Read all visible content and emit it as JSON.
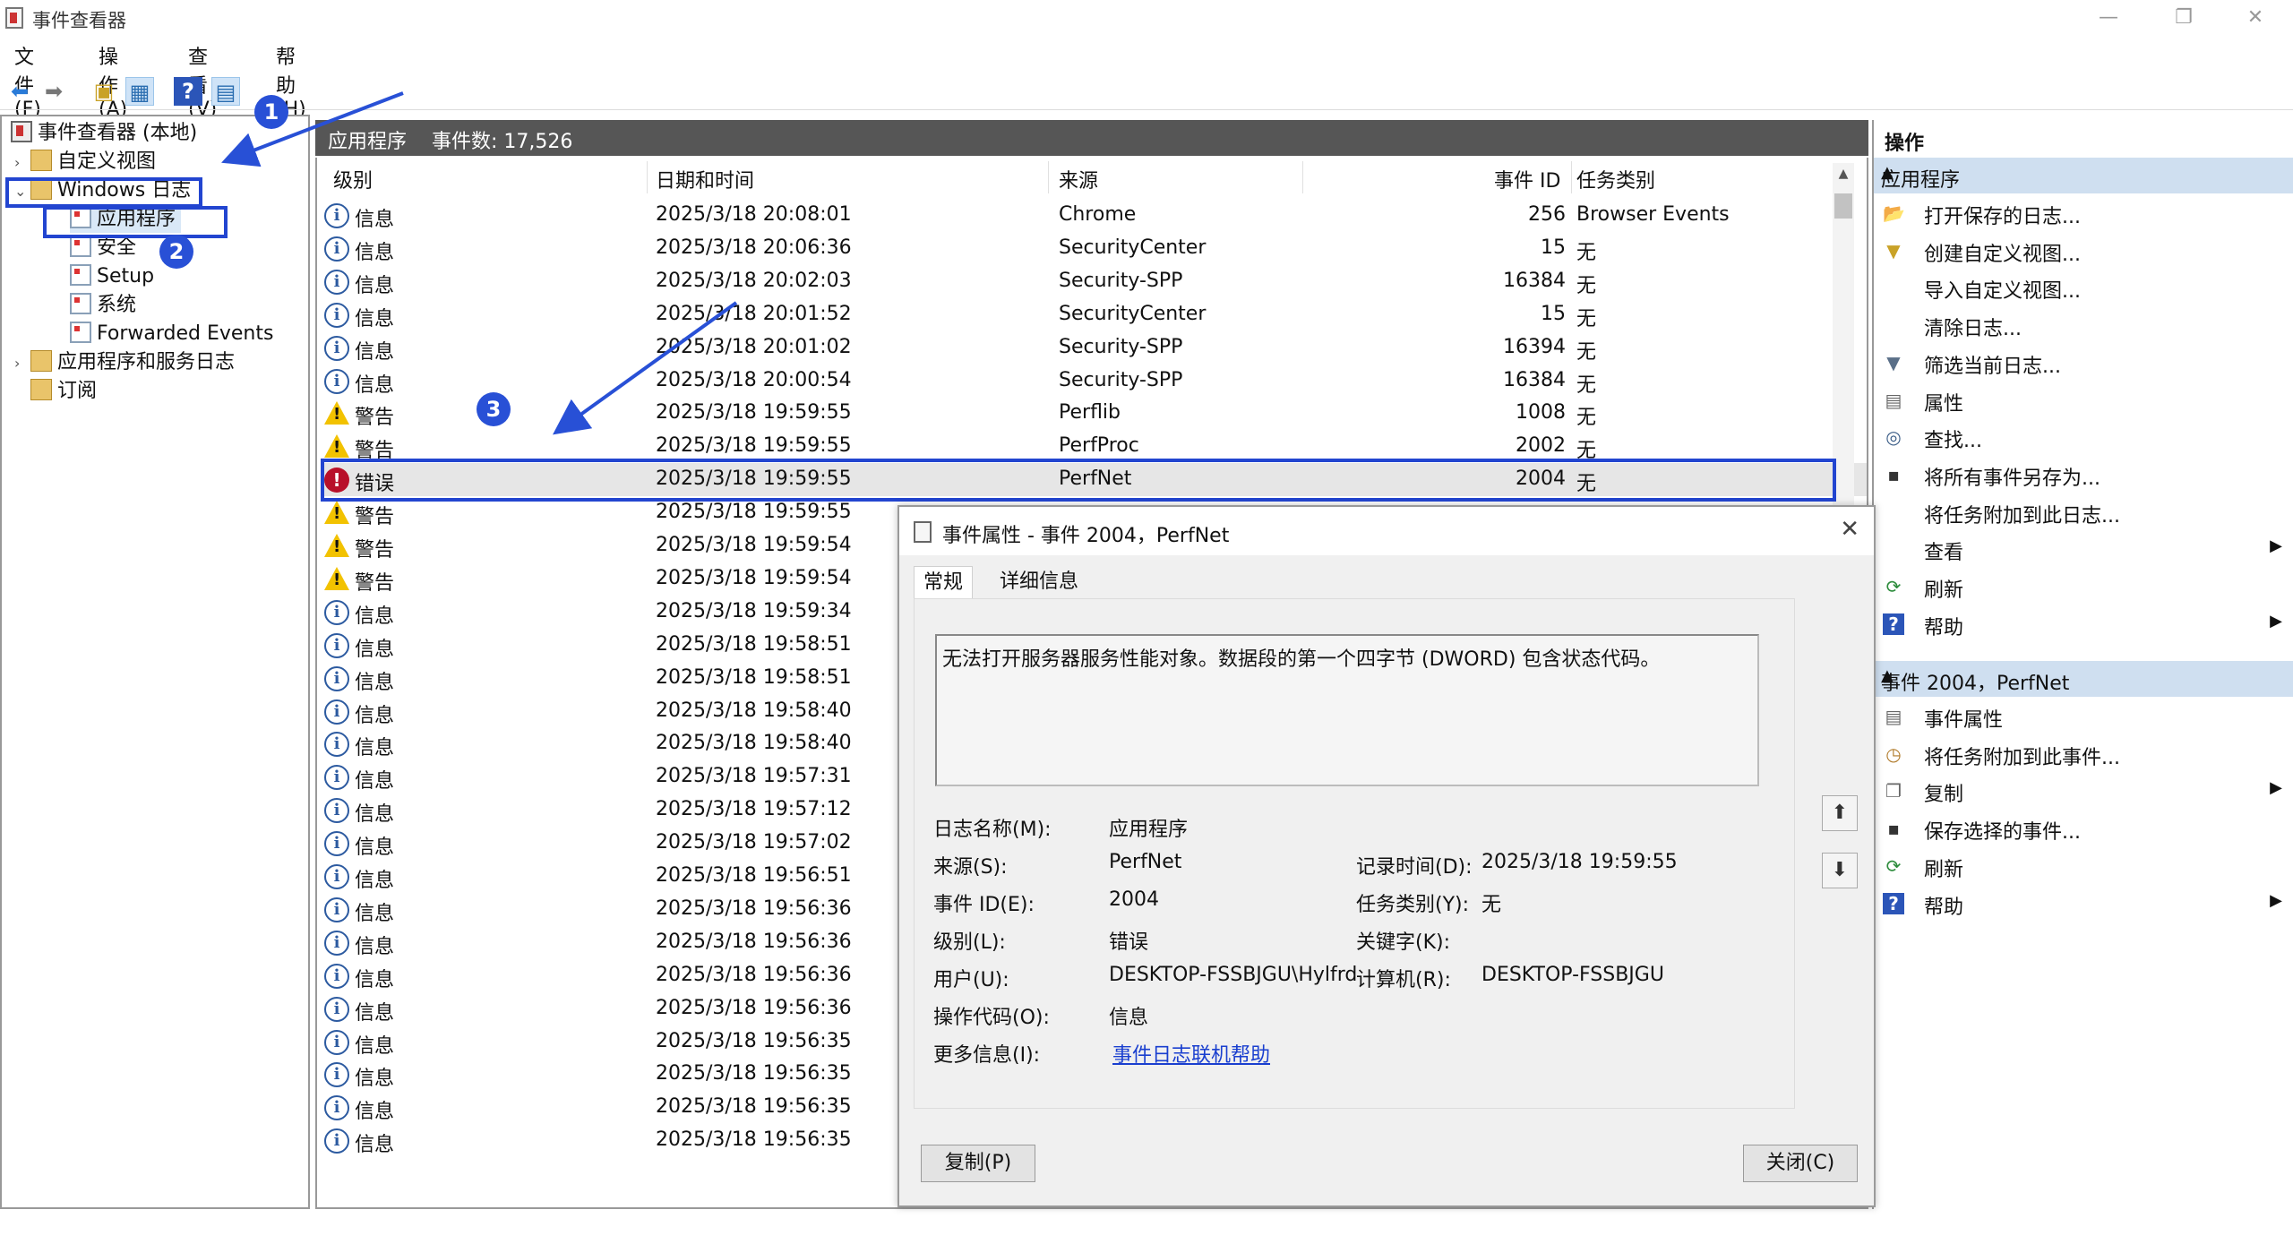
{
  "window": {
    "title": "事件查看器",
    "controls": {
      "min": "—",
      "max": "❐",
      "close": "✕"
    }
  },
  "menu": [
    "文件(F)",
    "操作(A)",
    "查看(V)",
    "帮助(H)"
  ],
  "tree": {
    "root": "事件查看器 (本地)",
    "custom_views": "自定义视图",
    "windows_logs": "Windows 日志",
    "application": "应用程序",
    "security": "安全",
    "setup": "Setup",
    "system": "系统",
    "forwarded": "Forwarded Events",
    "app_service_logs": "应用程序和服务日志",
    "subscriptions": "订阅"
  },
  "list": {
    "header_title": "应用程序",
    "event_count": "事件数: 17,526",
    "columns": {
      "level": "级别",
      "datetime": "日期和时间",
      "source": "来源",
      "event_id": "事件 ID",
      "task": "任务类别"
    },
    "rows": [
      {
        "icon": "info",
        "level": "信息",
        "datetime": "2025/3/18 20:08:01",
        "source": "Chrome",
        "event_id": "256",
        "task": "Browser Events"
      },
      {
        "icon": "info",
        "level": "信息",
        "datetime": "2025/3/18 20:06:36",
        "source": "SecurityCenter",
        "event_id": "15",
        "task": "无"
      },
      {
        "icon": "info",
        "level": "信息",
        "datetime": "2025/3/18 20:02:03",
        "source": "Security-SPP",
        "event_id": "16384",
        "task": "无"
      },
      {
        "icon": "info",
        "level": "信息",
        "datetime": "2025/3/18 20:01:52",
        "source": "SecurityCenter",
        "event_id": "15",
        "task": "无"
      },
      {
        "icon": "info",
        "level": "信息",
        "datetime": "2025/3/18 20:01:02",
        "source": "Security-SPP",
        "event_id": "16394",
        "task": "无"
      },
      {
        "icon": "info",
        "level": "信息",
        "datetime": "2025/3/18 20:00:54",
        "source": "Security-SPP",
        "event_id": "16384",
        "task": "无"
      },
      {
        "icon": "warn",
        "level": "警告",
        "datetime": "2025/3/18 19:59:55",
        "source": "Perflib",
        "event_id": "1008",
        "task": "无"
      },
      {
        "icon": "warn",
        "level": "警告",
        "datetime": "2025/3/18 19:59:55",
        "source": "PerfProc",
        "event_id": "2002",
        "task": "无"
      },
      {
        "icon": "err",
        "level": "错误",
        "datetime": "2025/3/18 19:59:55",
        "source": "PerfNet",
        "event_id": "2004",
        "task": "无"
      },
      {
        "icon": "warn",
        "level": "警告",
        "datetime": "2025/3/18 19:59:55",
        "source": "",
        "event_id": "",
        "task": ""
      },
      {
        "icon": "warn",
        "level": "警告",
        "datetime": "2025/3/18 19:59:54",
        "source": "",
        "event_id": "",
        "task": ""
      },
      {
        "icon": "warn",
        "level": "警告",
        "datetime": "2025/3/18 19:59:54",
        "source": "",
        "event_id": "",
        "task": ""
      },
      {
        "icon": "info",
        "level": "信息",
        "datetime": "2025/3/18 19:59:34",
        "source": "",
        "event_id": "",
        "task": ""
      },
      {
        "icon": "info",
        "level": "信息",
        "datetime": "2025/3/18 19:58:51",
        "source": "",
        "event_id": "",
        "task": ""
      },
      {
        "icon": "info",
        "level": "信息",
        "datetime": "2025/3/18 19:58:51",
        "source": "",
        "event_id": "",
        "task": ""
      },
      {
        "icon": "info",
        "level": "信息",
        "datetime": "2025/3/18 19:58:40",
        "source": "",
        "event_id": "",
        "task": ""
      },
      {
        "icon": "info",
        "level": "信息",
        "datetime": "2025/3/18 19:58:40",
        "source": "",
        "event_id": "",
        "task": ""
      },
      {
        "icon": "info",
        "level": "信息",
        "datetime": "2025/3/18 19:57:31",
        "source": "",
        "event_id": "",
        "task": ""
      },
      {
        "icon": "info",
        "level": "信息",
        "datetime": "2025/3/18 19:57:12",
        "source": "",
        "event_id": "",
        "task": ""
      },
      {
        "icon": "info",
        "level": "信息",
        "datetime": "2025/3/18 19:57:02",
        "source": "",
        "event_id": "",
        "task": ""
      },
      {
        "icon": "info",
        "level": "信息",
        "datetime": "2025/3/18 19:56:51",
        "source": "",
        "event_id": "",
        "task": ""
      },
      {
        "icon": "info",
        "level": "信息",
        "datetime": "2025/3/18 19:56:36",
        "source": "",
        "event_id": "",
        "task": ""
      },
      {
        "icon": "info",
        "level": "信息",
        "datetime": "2025/3/18 19:56:36",
        "source": "",
        "event_id": "",
        "task": ""
      },
      {
        "icon": "info",
        "level": "信息",
        "datetime": "2025/3/18 19:56:36",
        "source": "",
        "event_id": "",
        "task": ""
      },
      {
        "icon": "info",
        "level": "信息",
        "datetime": "2025/3/18 19:56:36",
        "source": "",
        "event_id": "",
        "task": ""
      },
      {
        "icon": "info",
        "level": "信息",
        "datetime": "2025/3/18 19:56:35",
        "source": "",
        "event_id": "",
        "task": ""
      },
      {
        "icon": "info",
        "level": "信息",
        "datetime": "2025/3/18 19:56:35",
        "source": "",
        "event_id": "",
        "task": ""
      },
      {
        "icon": "info",
        "level": "信息",
        "datetime": "2025/3/18 19:56:35",
        "source": "",
        "event_id": "",
        "task": ""
      },
      {
        "icon": "info",
        "level": "信息",
        "datetime": "2025/3/18 19:56:35",
        "source": "",
        "event_id": "",
        "task": ""
      }
    ]
  },
  "actions": {
    "title": "操作",
    "section1": "应用程序",
    "items1": [
      {
        "icon": "open-folder-icon",
        "label": "打开保存的日志..."
      },
      {
        "icon": "filter-create-icon",
        "label": "创建自定义视图..."
      },
      {
        "icon": "",
        "label": "导入自定义视图..."
      },
      {
        "icon": "",
        "label": "清除日志..."
      },
      {
        "icon": "filter-icon",
        "label": "筛选当前日志..."
      },
      {
        "icon": "properties-icon",
        "label": "属性"
      },
      {
        "icon": "binoculars-icon",
        "label": "查找..."
      },
      {
        "icon": "save-icon",
        "label": "将所有事件另存为..."
      },
      {
        "icon": "",
        "label": "将任务附加到此日志..."
      },
      {
        "icon": "",
        "label": "查看",
        "submenu": "▶"
      },
      {
        "icon": "refresh-icon",
        "label": "刷新"
      },
      {
        "icon": "help-icon",
        "label": "帮助",
        "submenu": "▶"
      }
    ],
    "section2": "事件 2004，PerfNet",
    "items2": [
      {
        "icon": "event-properties-icon",
        "label": "事件属性"
      },
      {
        "icon": "attach-task-icon",
        "label": "将任务附加到此事件..."
      },
      {
        "icon": "copy-icon",
        "label": "复制",
        "submenu": "▶"
      },
      {
        "icon": "save-icon",
        "label": "保存选择的事件..."
      },
      {
        "icon": "refresh-icon",
        "label": "刷新"
      },
      {
        "icon": "help-icon",
        "label": "帮助",
        "submenu": "▶"
      }
    ]
  },
  "dialog": {
    "title": "事件属性 - 事件 2004，PerfNet",
    "tabs": [
      "常规",
      "详细信息"
    ],
    "message": "无法打开服务器服务性能对象。数据段的第一个四字节 (DWORD) 包含状态代码。",
    "fields": {
      "log_name_label": "日志名称(M):",
      "log_name": "应用程序",
      "source_label": "来源(S):",
      "source": "PerfNet",
      "logged_label": "记录时间(D):",
      "logged": "2025/3/18 19:59:55",
      "event_id_label": "事件 ID(E):",
      "event_id": "2004",
      "task_label": "任务类别(Y):",
      "task": "无",
      "level_label": "级别(L):",
      "level": "错误",
      "keywords_label": "关键字(K):",
      "keywords": "",
      "user_label": "用户(U):",
      "user": "DESKTOP-FSSBJGU\\Hylfrd",
      "computer_label": "计算机(R):",
      "computer": "DESKTOP-FSSBJGU",
      "opcode_label": "操作代码(O):",
      "opcode": "信息",
      "more_label": "更多信息(I):",
      "more_link": "事件日志联机帮助"
    },
    "copy_button": "复制(P)",
    "close_button": "关闭(C)"
  },
  "annotations": {
    "badge1": "1",
    "badge2": "2",
    "badge3": "3"
  },
  "colors": {
    "highlight": "#2245d0",
    "badge": "#2850d6",
    "list_header": "#565656",
    "section": "#cfdff0"
  }
}
